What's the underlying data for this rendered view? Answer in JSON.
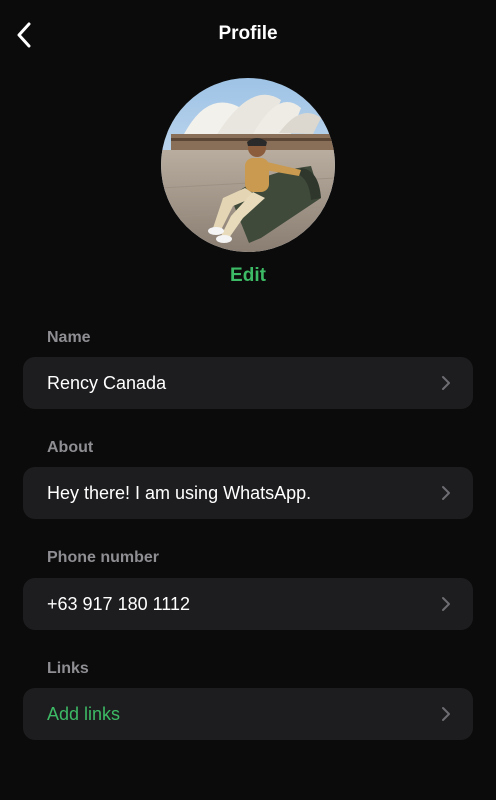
{
  "header": {
    "title": "Profile",
    "back_icon": "chevron-left-icon"
  },
  "avatar": {
    "description_icon": "profile-photo",
    "edit_label": "Edit"
  },
  "fields": {
    "name": {
      "label": "Name",
      "value": "Rency Canada"
    },
    "about": {
      "label": "About",
      "value": "Hey there! I am using WhatsApp."
    },
    "phone": {
      "label": "Phone number",
      "value": "+63 917 180 1112"
    },
    "links": {
      "label": "Links",
      "value": "Add links"
    }
  },
  "colors": {
    "background": "#0b0b0b",
    "row_background": "#1d1d1f",
    "accent": "#3dba65",
    "label": "#8e8e93"
  }
}
